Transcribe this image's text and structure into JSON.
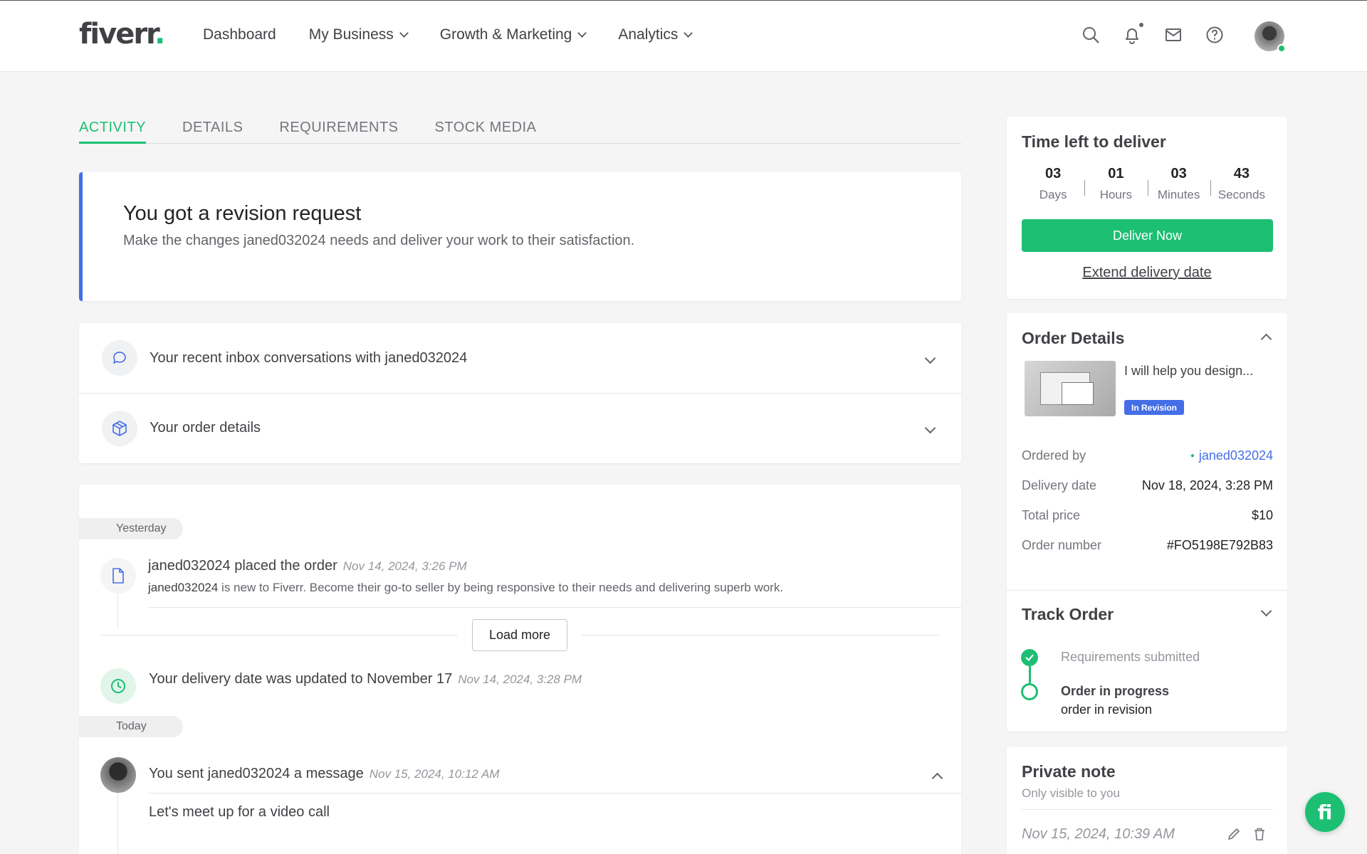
{
  "header": {
    "logo_text": "fiverr",
    "logo_dot": ".",
    "nav": [
      {
        "label": "Dashboard"
      },
      {
        "label": "My Business"
      },
      {
        "label": "Growth & Marketing"
      },
      {
        "label": "Analytics"
      }
    ],
    "icons": [
      "search-icon",
      "bell-icon",
      "mail-icon",
      "help-icon"
    ]
  },
  "tabs": [
    "ACTIVITY",
    "DETAILS",
    "REQUIREMENTS",
    "STOCK MEDIA"
  ],
  "revision": {
    "title": "You got a revision request",
    "message": "Make the changes janed032024 needs and deliver your work to their satisfaction."
  },
  "accordion": [
    {
      "label": "Your recent inbox conversations with janed032024"
    },
    {
      "label": "Your order details"
    }
  ],
  "activity": {
    "yesterday_label": "Yesterday",
    "today_label": "Today",
    "placed": {
      "title": "janed032024 placed the order",
      "time": "Nov 14, 2024, 3:26 PM",
      "user": "janed032024",
      "body": " is new to Fiverr. Become their go-to seller by being responsive to their needs and delivering superb work."
    },
    "load_more": "Load more",
    "delivery_update": {
      "title": "Your delivery date was updated to November 17",
      "time": "Nov 14, 2024, 3:28 PM"
    },
    "message": {
      "title": "You sent janed032024 a message",
      "time": "Nov 15, 2024, 10:12 AM",
      "body": "Let's meet up for a video call"
    }
  },
  "time_left": {
    "title": "Time left to deliver",
    "units": [
      {
        "value": "03",
        "label": "Days"
      },
      {
        "value": "01",
        "label": "Hours"
      },
      {
        "value": "03",
        "label": "Minutes"
      },
      {
        "value": "43",
        "label": "Seconds"
      }
    ],
    "deliver_label": "Deliver Now",
    "extend_label": "Extend delivery date"
  },
  "order_details": {
    "title": "Order Details",
    "gig_title": "I will help you design...",
    "status_badge": "In Revision",
    "rows": [
      {
        "key": "Ordered by",
        "value": "janed032024"
      },
      {
        "key": "Delivery date",
        "value": "Nov 18, 2024, 3:28 PM"
      },
      {
        "key": "Total price",
        "value": "$10"
      },
      {
        "key": "Order number",
        "value": "#FO5198E792B83"
      }
    ]
  },
  "track_order": {
    "title": "Track Order",
    "steps": [
      {
        "label": "Requirements submitted"
      },
      {
        "label": "Order in progress",
        "sub": "order in revision"
      }
    ]
  },
  "private_note": {
    "title": "Private note",
    "subtitle": "Only visible to you",
    "timestamp": "Nov 15, 2024, 10:39 AM"
  },
  "fab_label": "fi",
  "colors": {
    "brand_green": "#1dbf73",
    "accent_blue": "#446ee7"
  }
}
